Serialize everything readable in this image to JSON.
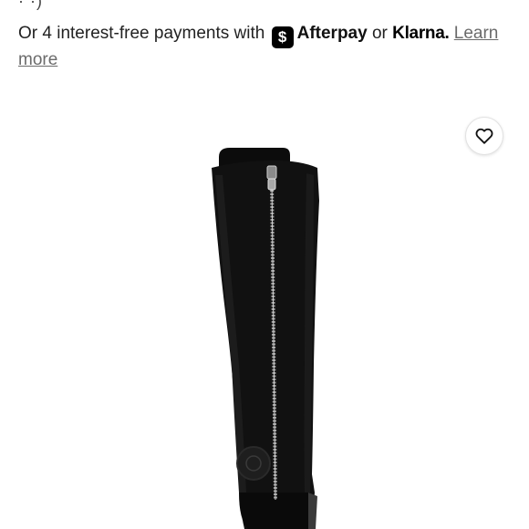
{
  "top_text": "·   ·)",
  "payments": {
    "prefix": "Or 4 interest-free payments with",
    "afterpay_icon": "$",
    "afterpay": "Afterpay",
    "or": "or",
    "klarna": "Klarna.",
    "learn_more": "Learn more"
  },
  "product": {
    "image_icon": "knee-high-black-boot-with-zipper",
    "favorite_icon": "heart-outline-icon"
  }
}
